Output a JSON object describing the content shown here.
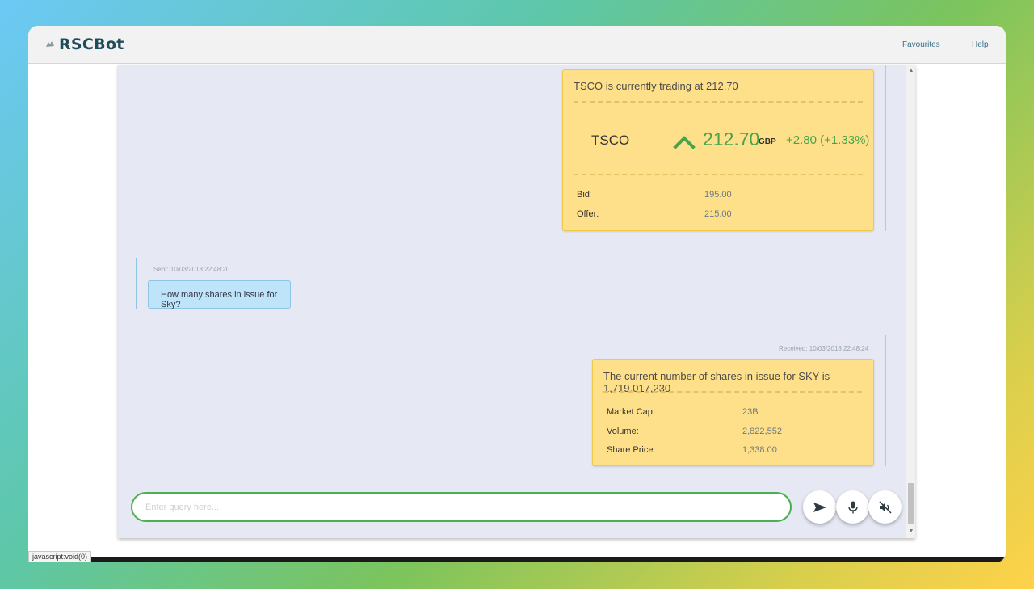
{
  "header": {
    "logo": "RSCBot",
    "nav": {
      "favourites": "Favourites",
      "help": "Help"
    }
  },
  "messages": {
    "stock_quote": {
      "title": "TSCO is currently trading at 212.70",
      "ticker": "TSCO",
      "price": "212.70",
      "currency": "GBP",
      "change": "+2.80 (+1.33%)",
      "bid_label": "Bid:",
      "bid_value": "195.00",
      "offer_label": "Offer:",
      "offer_value": "215.00"
    },
    "user_query": {
      "timestamp": "Sent: 10/03/2018 22:48:20",
      "text": "How many shares in issue for Sky?"
    },
    "shares_reply": {
      "timestamp": "Received: 10/03/2018 22:48:24",
      "title": "The current number of shares in issue for SKY is 1,719,017,230",
      "market_cap_label": "Market Cap:",
      "market_cap_value": "23B",
      "volume_label": "Volume:",
      "volume_value": "2,822,552",
      "share_price_label": "Share Price:",
      "share_price_value": "1,338.00"
    }
  },
  "input": {
    "placeholder": "Enter query here..."
  },
  "icons": {
    "send": "send-icon",
    "mic": "microphone-icon",
    "mute": "speaker-muted-icon",
    "trend": "arrow-up-icon"
  },
  "colors": {
    "accent_green": "#4caf50",
    "bot_card": "#ffe08a",
    "user_bubble": "#bde4f8",
    "logo": "#1f4d5a"
  },
  "status_bar": {
    "text": "javascript:void(0)"
  }
}
